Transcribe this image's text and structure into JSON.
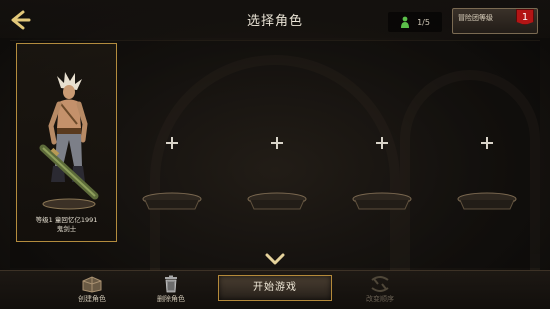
{
  "header": {
    "title": "选择角色",
    "slot_count": "1/5",
    "adventure_button_label": "冒险团等级",
    "adventure_level": "1"
  },
  "slots": [
    {
      "state": "occupied",
      "line1": "等级1 童回忆亿1991",
      "line2": "鬼剑士"
    },
    {
      "state": "empty"
    },
    {
      "state": "empty"
    },
    {
      "state": "empty"
    },
    {
      "state": "empty"
    }
  ],
  "footer": {
    "create_label": "创建角色",
    "delete_label": "删除角色",
    "start_label": "开始游戏",
    "sort_label": "改变顺序"
  },
  "colors": {
    "accent_gold": "#b38c3e",
    "badge_red": "#b31515",
    "counter_icon_green": "#5bbf4a"
  },
  "icons": [
    "back-arrow-icon",
    "character-count-icon",
    "plus-icon",
    "pedestal-icon",
    "chevron-down-icon",
    "create-icon",
    "trash-icon",
    "sort-icon"
  ]
}
